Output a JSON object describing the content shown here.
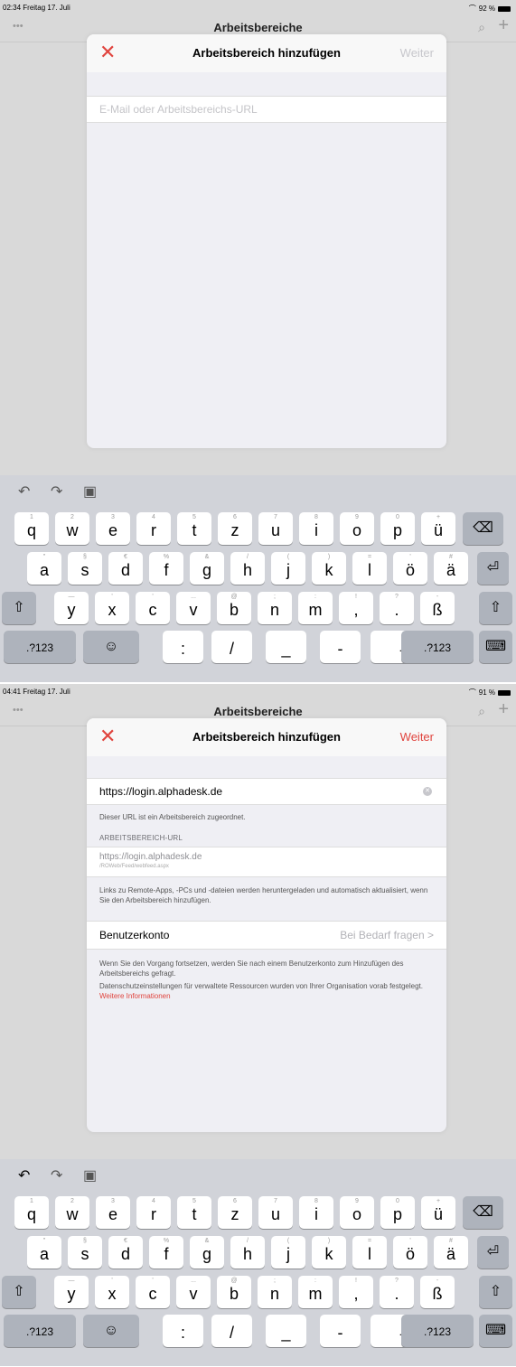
{
  "screens": [
    {
      "status": {
        "time": "02:34",
        "date": "Freitag 17. Juli",
        "battery": "92 %",
        "wifi_icon": "wifi-icon"
      },
      "background": {
        "dots": "•••",
        "title": "Arbeitsbereiche"
      },
      "modal": {
        "close": "✕",
        "title": "Arbeitsbereich hinzufügen",
        "next": "Weiter",
        "next_enabled": false,
        "input_placeholder": "E-Mail oder Arbeitsbereichs-URL"
      },
      "keyboard": "default"
    },
    {
      "status": {
        "time": "04:41",
        "date": "Freitag 17. Juli",
        "battery": "91 %",
        "wifi_icon": "wifi-icon"
      },
      "background": {
        "dots": "•••",
        "title": "Arbeitsbereiche"
      },
      "modal": {
        "close": "✕",
        "title": "Arbeitsbereich hinzufügen",
        "next": "Weiter",
        "next_enabled": true,
        "input_value": "https://login.alphadesk.de",
        "assigned_note": "Dieser URL ist ein Arbeitsbereich zugeordnet.",
        "section_label": "ARBEITSBEREICH-URL",
        "url_line1": "https://login.alphadesk.de",
        "url_line2": "/ROWeb/Feed/webfeed.aspx",
        "links_note": "Links zu Remote-Apps, -PCs und -dateien werden heruntergeladen und automatisch aktualisiert, wenn Sie den Arbeitsbereich hinzufügen.",
        "account_label": "Benutzerkonto",
        "account_value": "Bei Bedarf fragen",
        "continue_note": "Wenn Sie den Vorgang fortsetzen, werden Sie nach einem Benutzerkonto zum Hinzufügen des Arbeitsbereichs gefragt.",
        "privacy_note": "Datenschutzeinstellungen für verwaltete Ressourcen wurden von Ihrer Organisation vorab festgelegt.",
        "privacy_link": "Weitere Informationen"
      },
      "keyboard": "default"
    }
  ],
  "colors": {
    "accent": "#e0443e",
    "disabled": "#c7c7cc"
  },
  "keyboard": {
    "suggestion_icons": [
      "undo-icon",
      "redo-icon",
      "paste-icon"
    ],
    "row1": [
      {
        "m": "q",
        "h": "1"
      },
      {
        "m": "w",
        "h": "2"
      },
      {
        "m": "e",
        "h": "3"
      },
      {
        "m": "r",
        "h": "4"
      },
      {
        "m": "t",
        "h": "5"
      },
      {
        "m": "z",
        "h": "6"
      },
      {
        "m": "u",
        "h": "7"
      },
      {
        "m": "i",
        "h": "8"
      },
      {
        "m": "o",
        "h": "9"
      },
      {
        "m": "p",
        "h": "0"
      },
      {
        "m": "ü",
        "h": "+"
      }
    ],
    "row2": [
      {
        "m": "a",
        "h": "\""
      },
      {
        "m": "s",
        "h": "§"
      },
      {
        "m": "d",
        "h": "€"
      },
      {
        "m": "f",
        "h": "%"
      },
      {
        "m": "g",
        "h": "&"
      },
      {
        "m": "h",
        "h": "/"
      },
      {
        "m": "j",
        "h": "("
      },
      {
        "m": "k",
        "h": ")"
      },
      {
        "m": "l",
        "h": "="
      },
      {
        "m": "ö",
        "h": "'"
      },
      {
        "m": "ä",
        "h": "#"
      }
    ],
    "row3": [
      {
        "m": "y",
        "h": "—"
      },
      {
        "m": "x",
        "h": "'"
      },
      {
        "m": "c",
        "h": "'"
      },
      {
        "m": "v",
        "h": "..."
      },
      {
        "m": "b",
        "h": "@"
      },
      {
        "m": "n",
        "h": ";"
      },
      {
        "m": "m",
        "h": ":"
      },
      {
        "m": ",",
        "h": "!"
      },
      {
        "m": ".",
        "h": "?"
      },
      {
        "m": "ß",
        "h": "-"
      }
    ],
    "row4": [
      ":",
      "/",
      "_",
      "-",
      ".de"
    ],
    "numbers_label": ".?123",
    "icons": {
      "backspace": "⌫",
      "return": "⏎",
      "shift": "⇧",
      "emoji": "☺",
      "hide": "⌨"
    }
  }
}
